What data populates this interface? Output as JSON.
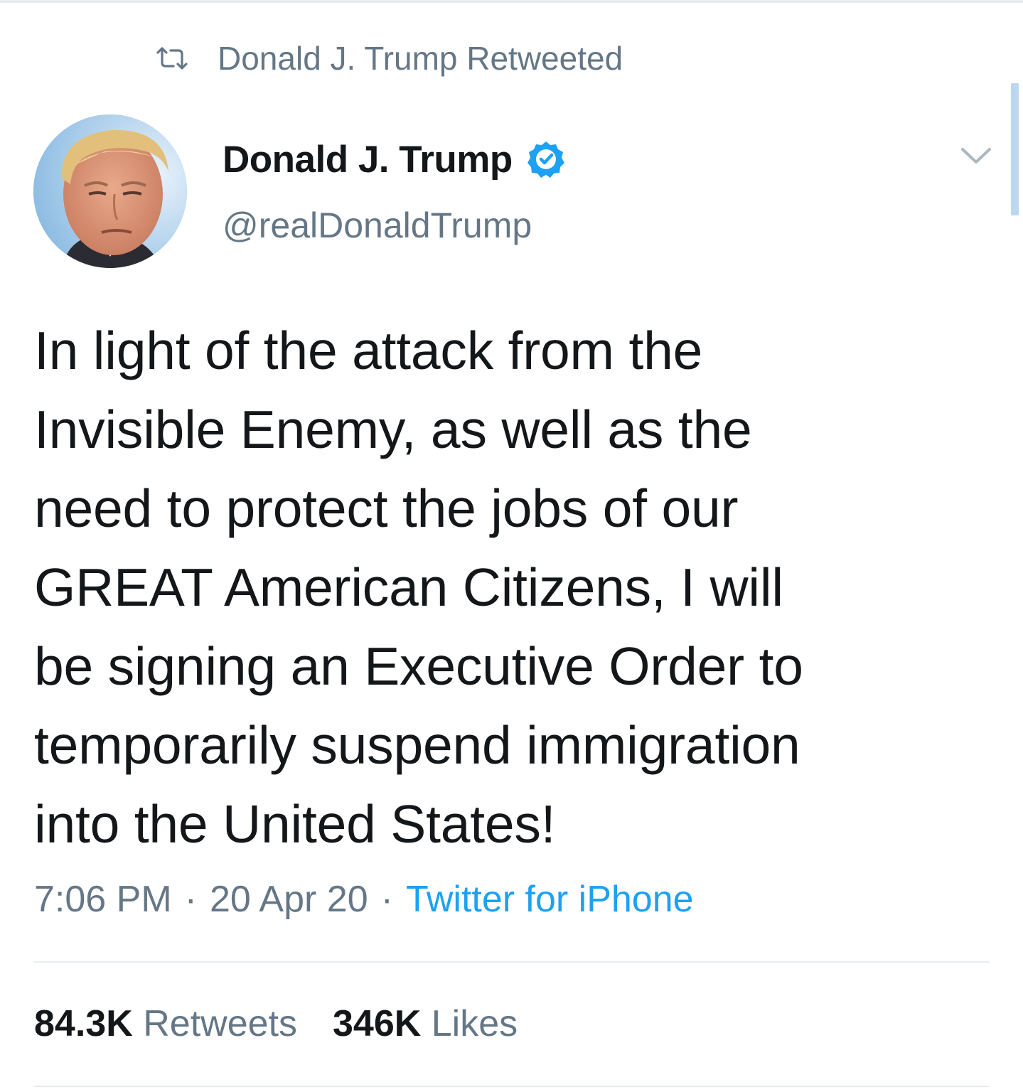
{
  "retweet_context": {
    "icon": "retweet-icon",
    "text": "Donald J. Trump Retweeted"
  },
  "author": {
    "display_name": "Donald J. Trump",
    "verified": true,
    "verified_icon": "verified-badge-icon",
    "handle": "@realDonaldTrump",
    "avatar_icon": "avatar"
  },
  "menu": {
    "icon": "chevron-down-icon"
  },
  "tweet": {
    "lines": [
      "In light of the attack from the",
      "Invisible Enemy, as well as the",
      "need to protect the jobs of our",
      "GREAT American Citizens, I will",
      "be signing an Executive Order to",
      "temporarily suspend immigration",
      "into the United States!"
    ]
  },
  "meta": {
    "time": "7:06 PM",
    "separator": "·",
    "date": "20 Apr 20",
    "source": "Twitter for iPhone"
  },
  "stats": {
    "retweets_count": "84.3K",
    "retweets_label": "Retweets",
    "likes_count": "346K",
    "likes_label": "Likes"
  },
  "colors": {
    "text_primary": "#14171a",
    "text_secondary": "#657786",
    "link": "#1da1f2",
    "verified": "#1da1f2",
    "divider": "#e6ecf0"
  }
}
